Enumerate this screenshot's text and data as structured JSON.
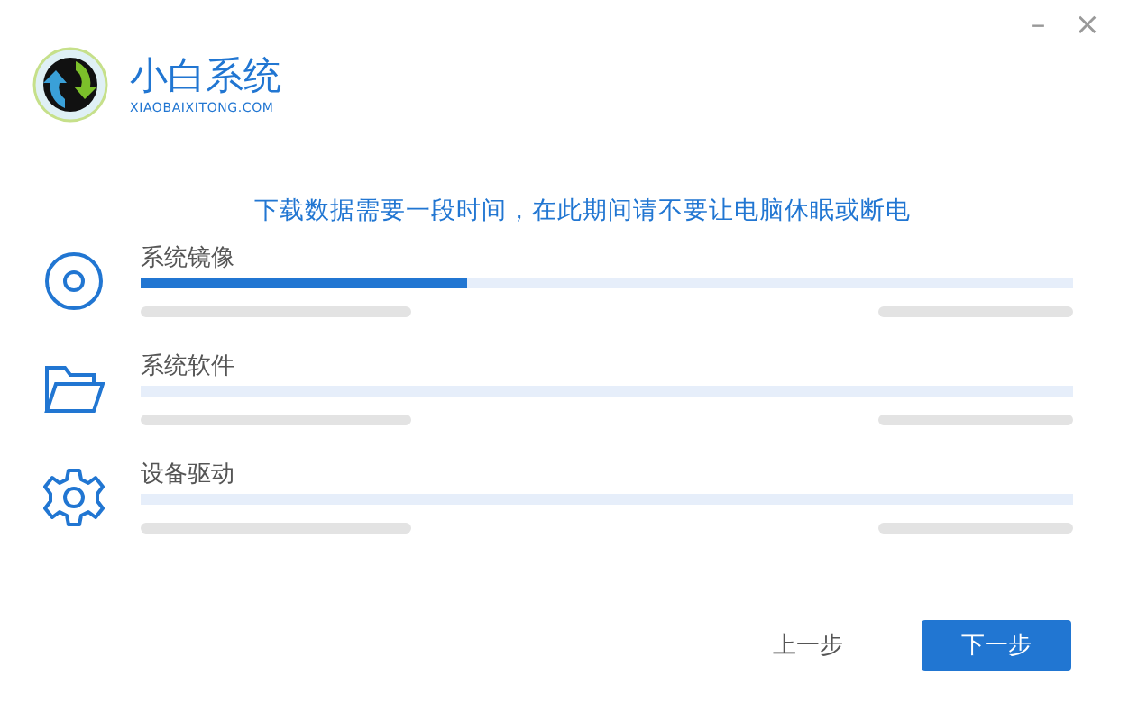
{
  "app": {
    "title": "小白系统",
    "subtitle": "XIAOBAIXITONG.COM"
  },
  "window_controls": [
    "–",
    "×"
  ],
  "message": "下载数据需要一段时间，在此期间请不要让电脑休眠或断电",
  "items": [
    {
      "kind": "disc",
      "label": "系统镜像",
      "level": 0.35
    },
    {
      "kind": "folder",
      "label": "系统软件"
    },
    {
      "kind": "gear",
      "label": "设备驱动"
    }
  ],
  "buttons": [
    {
      "label": "上一步",
      "kind": "secondary"
    },
    {
      "label": "下一步",
      "kind": "primary"
    }
  ]
}
